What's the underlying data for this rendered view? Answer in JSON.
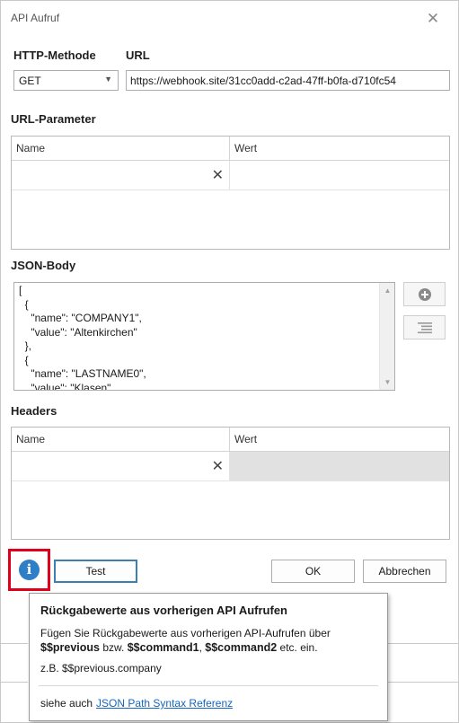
{
  "dialog": {
    "title": "API Aufruf",
    "close_glyph": "✕"
  },
  "method": {
    "label": "HTTP-Methode",
    "value": "GET",
    "arrow_glyph": "▼"
  },
  "url": {
    "label": "URL",
    "value": "https://webhook.site/31cc0add-c2ad-47ff-b0fa-d710fc54"
  },
  "url_params": {
    "label": "URL-Parameter",
    "col_name": "Name",
    "col_value": "Wert",
    "clear_glyph": "✕"
  },
  "json_body": {
    "label": "JSON-Body",
    "content": "[\n  {\n    \"name\": \"COMPANY1\",\n    \"value\": \"Altenkirchen\"\n  },\n  {\n    \"name\": \"LASTNAME0\",\n    \"value\": \"Klasen\"",
    "scroll_up_glyph": "▲",
    "scroll_down_glyph": "▼"
  },
  "headers": {
    "label": "Headers",
    "col_name": "Name",
    "col_value": "Wert",
    "clear_glyph": "✕"
  },
  "buttons": {
    "info_glyph": "i",
    "test": "Test",
    "ok": "OK",
    "cancel": "Abbrechen"
  },
  "tooltip": {
    "title": "Rückgabewerte aus vorherigen API Aufrufen",
    "line1": "Fügen Sie Rückgabewerte aus vorherigen API-Aufrufen über",
    "var_previous": "$$previous",
    "sep_bzw": " bzw. ",
    "var_command1": "$$command1",
    "sep_comma": ", ",
    "var_command2": "$$command2",
    "suffix": " etc. ein.",
    "example": "z.B. $$previous.company",
    "see_also": "siehe auch",
    "link": "JSON Path Syntax Referenz"
  },
  "icons": [
    "close-icon",
    "dropdown-arrow-icon",
    "clear-icon",
    "add-icon",
    "list-icon",
    "info-icon"
  ],
  "colors": {
    "info_blue": "#2f7fc6",
    "highlight_red": "#e0001b",
    "link_blue": "#1565c0",
    "focus_border": "#3c7fb1"
  }
}
